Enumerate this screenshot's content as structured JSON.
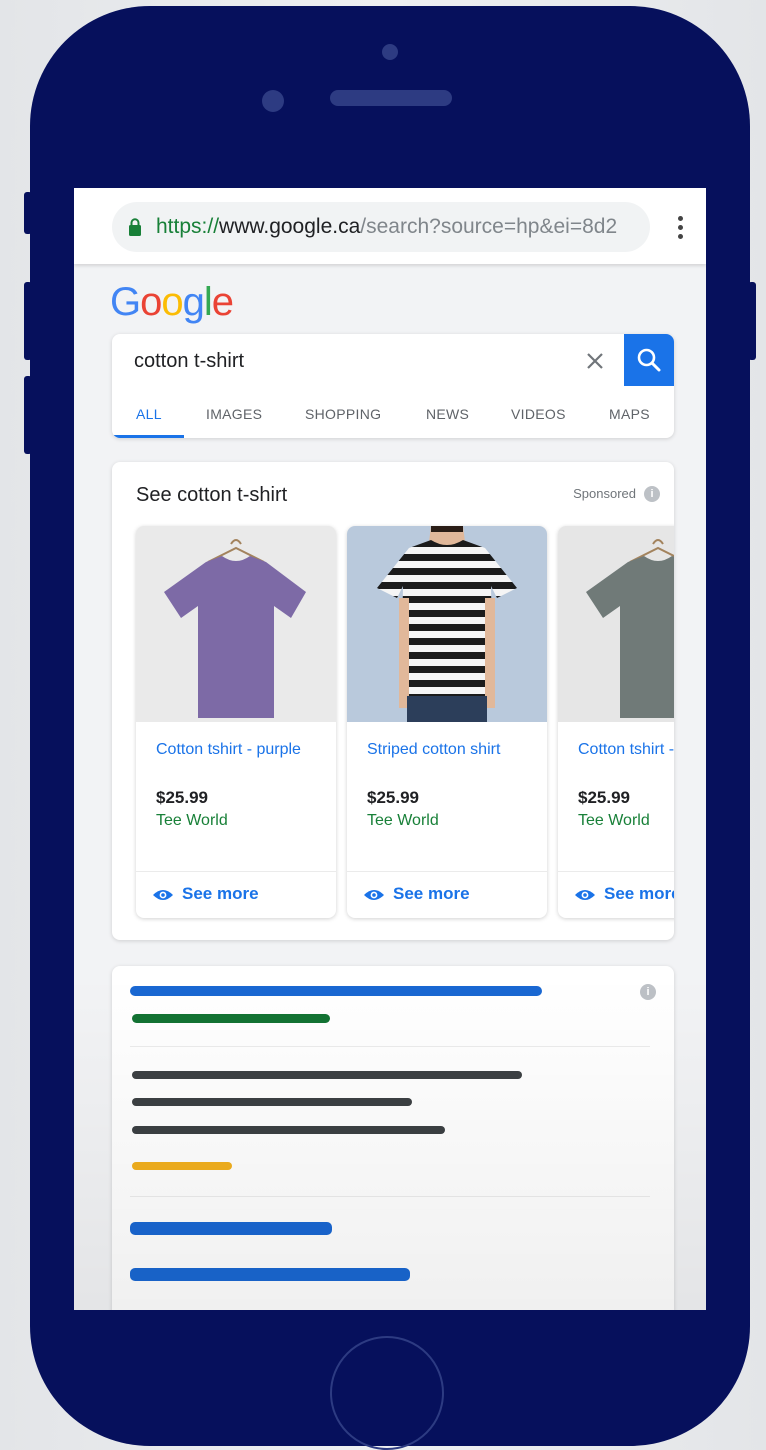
{
  "browser": {
    "url_scheme": "https://",
    "url_host": "www.google.ca",
    "url_path": "/search?source=hp&ei=8d2",
    "lock_icon": "lock-icon",
    "menu_icon": "more-vert-icon"
  },
  "logo": {
    "letters": [
      "G",
      "o",
      "o",
      "g",
      "l",
      "e"
    ],
    "colors": [
      "#4285F4",
      "#EA4335",
      "#FBBC05",
      "#4285F4",
      "#34A853",
      "#EA4335"
    ]
  },
  "search": {
    "query": "cotton t-shirt",
    "clear_icon": "close-icon",
    "search_icon": "search-icon"
  },
  "tabs": [
    {
      "label": "ALL",
      "active": true
    },
    {
      "label": "IMAGES",
      "active": false
    },
    {
      "label": "SHOPPING",
      "active": false
    },
    {
      "label": "NEWS",
      "active": false
    },
    {
      "label": "VIDEOS",
      "active": false
    },
    {
      "label": "MAPS",
      "active": false
    }
  ],
  "shopping_ads": {
    "title": "See cotton t-shirt",
    "sponsored_label": "Sponsored",
    "info_icon": "i",
    "products": [
      {
        "name": "Cotton tshirt - purple",
        "price": "$25.99",
        "store": "Tee World",
        "action": "See more",
        "shirt_color": "#7d6aa6"
      },
      {
        "name": "Striped cotton shirt",
        "price": "$25.99",
        "store": "Tee World",
        "action": "See more",
        "shirt_color": "#1b1b1b"
      },
      {
        "name": "Cotton tshirt - grey",
        "price": "$25.99",
        "store": "Tee World",
        "action": "See more",
        "shirt_color": "#707a78"
      }
    ]
  },
  "colors": {
    "phone_body": "#06105c",
    "link_blue": "#1a73e8",
    "store_green": "#188038",
    "placeholder_blue": "#1967d2",
    "placeholder_green": "#137333",
    "placeholder_dark": "#3c4043",
    "placeholder_yellow": "#f2b01e"
  }
}
